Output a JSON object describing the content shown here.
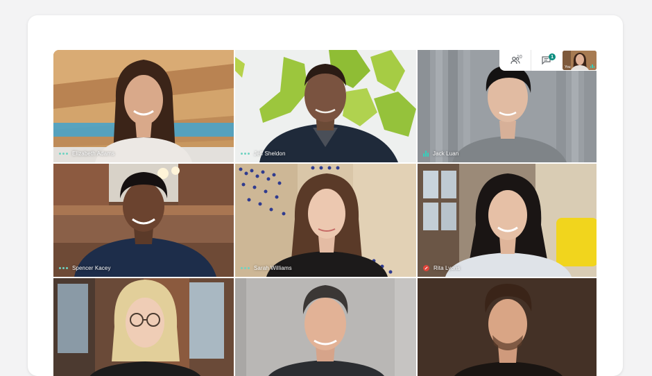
{
  "participants": [
    {
      "name": "Elizabeth Adams",
      "audio": "idle"
    },
    {
      "name": "Jeff Sheldon",
      "audio": "idle"
    },
    {
      "name": "Jack Luan",
      "audio": "speaking"
    },
    {
      "name": "Spencer Kacey",
      "audio": "idle"
    },
    {
      "name": "Sarah Williams",
      "audio": "idle"
    },
    {
      "name": "Rita Lyons",
      "audio": "muted"
    },
    {
      "name": "",
      "audio": ""
    },
    {
      "name": "",
      "audio": ""
    },
    {
      "name": "",
      "audio": ""
    }
  ],
  "toolbar": {
    "people_count": "10",
    "chat_unread": "1",
    "self_label": "You"
  },
  "icons": {
    "people": "people-icon",
    "chat": "chat-icon",
    "more": "more-dots-icon",
    "speaking": "audio-level-icon",
    "muted": "mic-off-icon"
  },
  "colors": {
    "accent": "#0b8d7f",
    "speaking": "#33d1bd",
    "muted": "#e0453b"
  }
}
